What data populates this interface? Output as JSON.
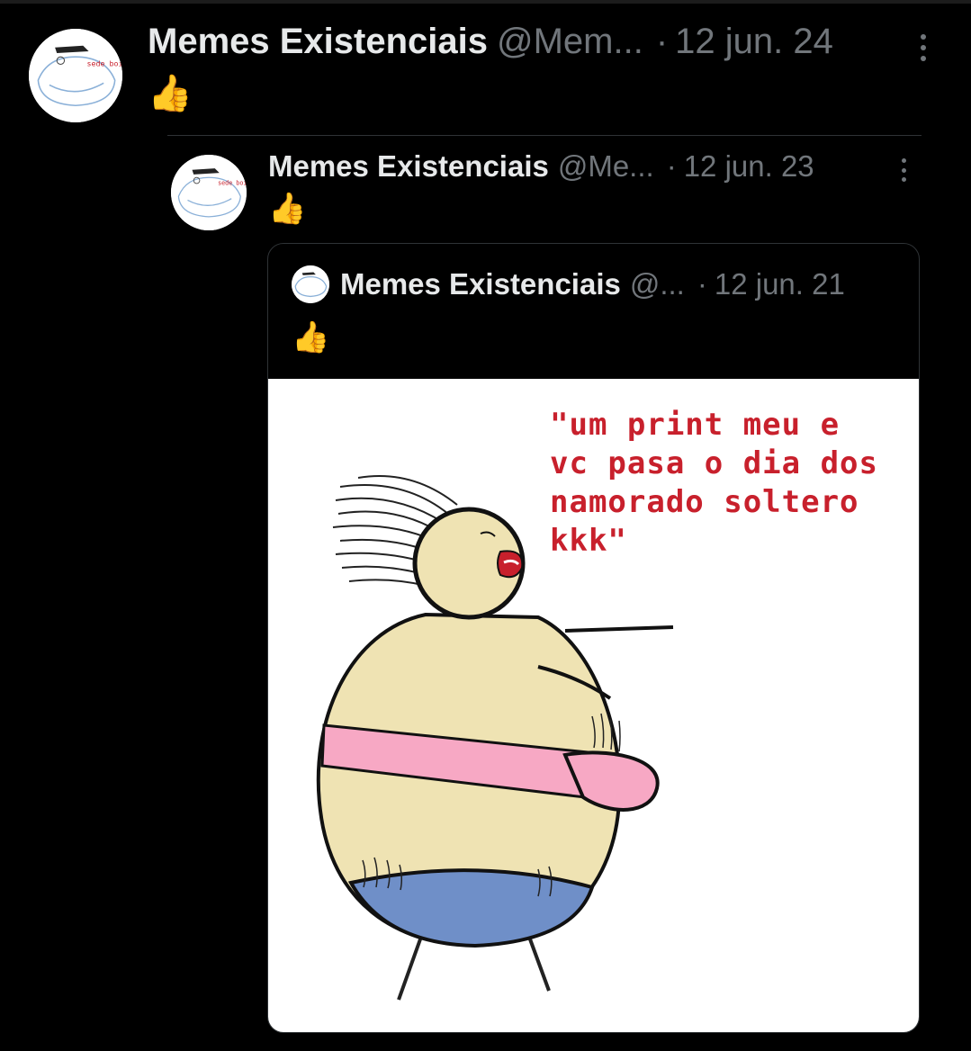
{
  "post": {
    "author_name": "Memes Existenciais",
    "author_handle": "@Mem...",
    "date": "12 jun. 24",
    "separator": "·",
    "text": "👍",
    "avatar_caption": "sede boi"
  },
  "reply": {
    "author_name": "Memes Existenciais",
    "author_handle": "@Me...",
    "date": "12 jun. 23",
    "separator": "·",
    "text": "👍",
    "avatar_caption": "sede boi"
  },
  "quote": {
    "author_name": "Memes Existenciais",
    "author_handle": "@...",
    "date": "12 jun. 21",
    "separator": "·",
    "text": "👍",
    "image": {
      "caption": "\"um print meu e\nvc pasa o dia dos\nnamorado soltero\nkkk\""
    }
  },
  "colors": {
    "background": "#000000",
    "name": "#e7e9ea",
    "secondary": "#71767b",
    "meme_text": "#c8202c",
    "skin": "#efe3b3",
    "shirt": "#f7a8c4",
    "pants": "#6f8fc8"
  },
  "icons": {
    "more": "more-vertical-icon",
    "emoji": "thumbs-up"
  }
}
